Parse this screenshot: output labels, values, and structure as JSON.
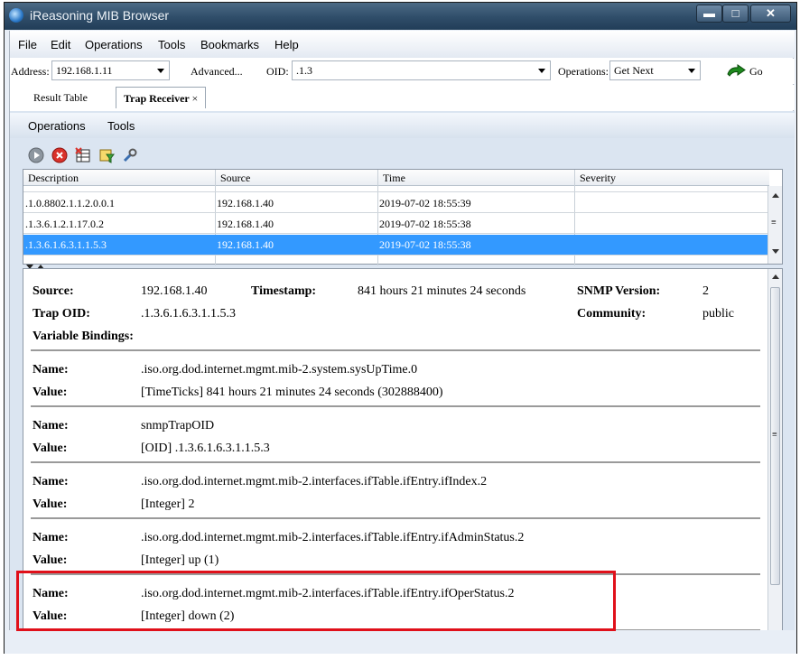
{
  "window": {
    "title": "iReasoning MIB Browser"
  },
  "menu": [
    "File",
    "Edit",
    "Operations",
    "Tools",
    "Bookmarks",
    "Help"
  ],
  "address_bar": {
    "address_label": "Address:",
    "address_value": "192.168.1.11",
    "advanced_label": "Advanced...",
    "oid_label": "OID:",
    "oid_value": ".1.3",
    "operations_label": "Operations:",
    "operations_value": "Get Next",
    "go_label": "Go"
  },
  "tabs": [
    {
      "label": "Result Table",
      "active": false
    },
    {
      "label": "Trap Receiver",
      "active": true,
      "close": "×"
    }
  ],
  "panel_menu": [
    "Operations",
    "Tools"
  ],
  "toolbar_icons": [
    "start-icon",
    "stop-icon",
    "delete-icon",
    "filter-icon",
    "settings-icon"
  ],
  "trap_table": {
    "columns": [
      "Description",
      "Source",
      "Time",
      "Severity"
    ],
    "rows": [
      {
        "description": ".1.0.8802.1.1.2.0.0.1",
        "source": "192.168.1.40",
        "time": "2019-07-02 18:55:39",
        "severity": ""
      },
      {
        "description": ".1.3.6.1.2.1.17.0.2",
        "source": "192.168.1.40",
        "time": "2019-07-02 18:55:38",
        "severity": ""
      },
      {
        "description": ".1.3.6.1.6.3.1.1.5.3",
        "source": "192.168.1.40",
        "time": "2019-07-02 18:55:38",
        "severity": ""
      }
    ],
    "selected_row": 2
  },
  "details": {
    "source_label": "Source:",
    "source_value": "192.168.1.40",
    "timestamp_label": "Timestamp:",
    "timestamp_value": "841 hours 21 minutes 24 seconds",
    "snmp_version_label": "SNMP Version:",
    "snmp_version_value": "2",
    "trap_oid_label": "Trap OID:",
    "trap_oid_value": ".1.3.6.1.6.3.1.1.5.3",
    "community_label": "Community:",
    "community_value": "public",
    "bindings_label": "Variable Bindings:",
    "name_label": "Name:",
    "value_label": "Value:",
    "bindings": [
      {
        "name": ".iso.org.dod.internet.mgmt.mib-2.system.sysUpTime.0",
        "value": "[TimeTicks] 841 hours 21 minutes 24 seconds (302888400)"
      },
      {
        "name": "snmpTrapOID",
        "value": "[OID] .1.3.6.1.6.3.1.1.5.3"
      },
      {
        "name": ".iso.org.dod.internet.mgmt.mib-2.interfaces.ifTable.ifEntry.ifIndex.2",
        "value": "[Integer] 2"
      },
      {
        "name": ".iso.org.dod.internet.mgmt.mib-2.interfaces.ifTable.ifEntry.ifAdminStatus.2",
        "value": "[Integer] up (1)"
      },
      {
        "name": ".iso.org.dod.internet.mgmt.mib-2.interfaces.ifTable.ifEntry.ifOperStatus.2",
        "value": "[Integer] down (2)"
      }
    ]
  },
  "colors": {
    "selection": "#3399ff",
    "highlight_box": "#e0101a",
    "titlebar": "#2f4d69"
  }
}
